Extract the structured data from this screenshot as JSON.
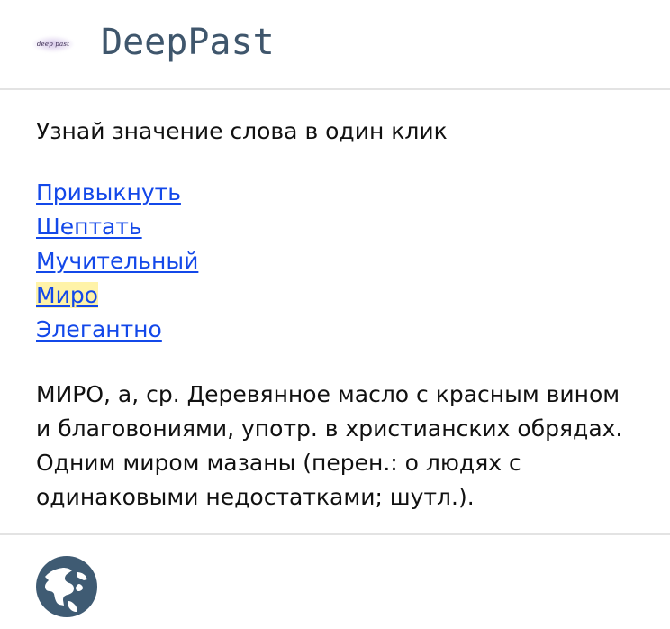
{
  "site": {
    "logo_text": "deep past",
    "title": "DeepPast"
  },
  "main": {
    "tagline": "Узнай значение слова в один клик",
    "words": [
      {
        "label": "Привыкнуть",
        "active": false
      },
      {
        "label": "Шептать",
        "active": false
      },
      {
        "label": "Мучительный",
        "active": false
      },
      {
        "label": "Миро",
        "active": true
      },
      {
        "label": "Элегантно",
        "active": false
      }
    ],
    "definition": "МИРО, а, ср. Деревянное масло с красным вином и благовониями, употр. в христианских обрядах. Одним миром мазаны (перен.: о людях с одинаковыми недостатками; шутл.)."
  },
  "footer": {
    "icon": "globe-icon"
  },
  "colors": {
    "title": "#3f566c",
    "link": "#1348e9",
    "highlight": "#fff3a8",
    "divider": "#e3e3e3",
    "globe_ocean": "#3f5b73",
    "globe_land": "#ffffff"
  }
}
